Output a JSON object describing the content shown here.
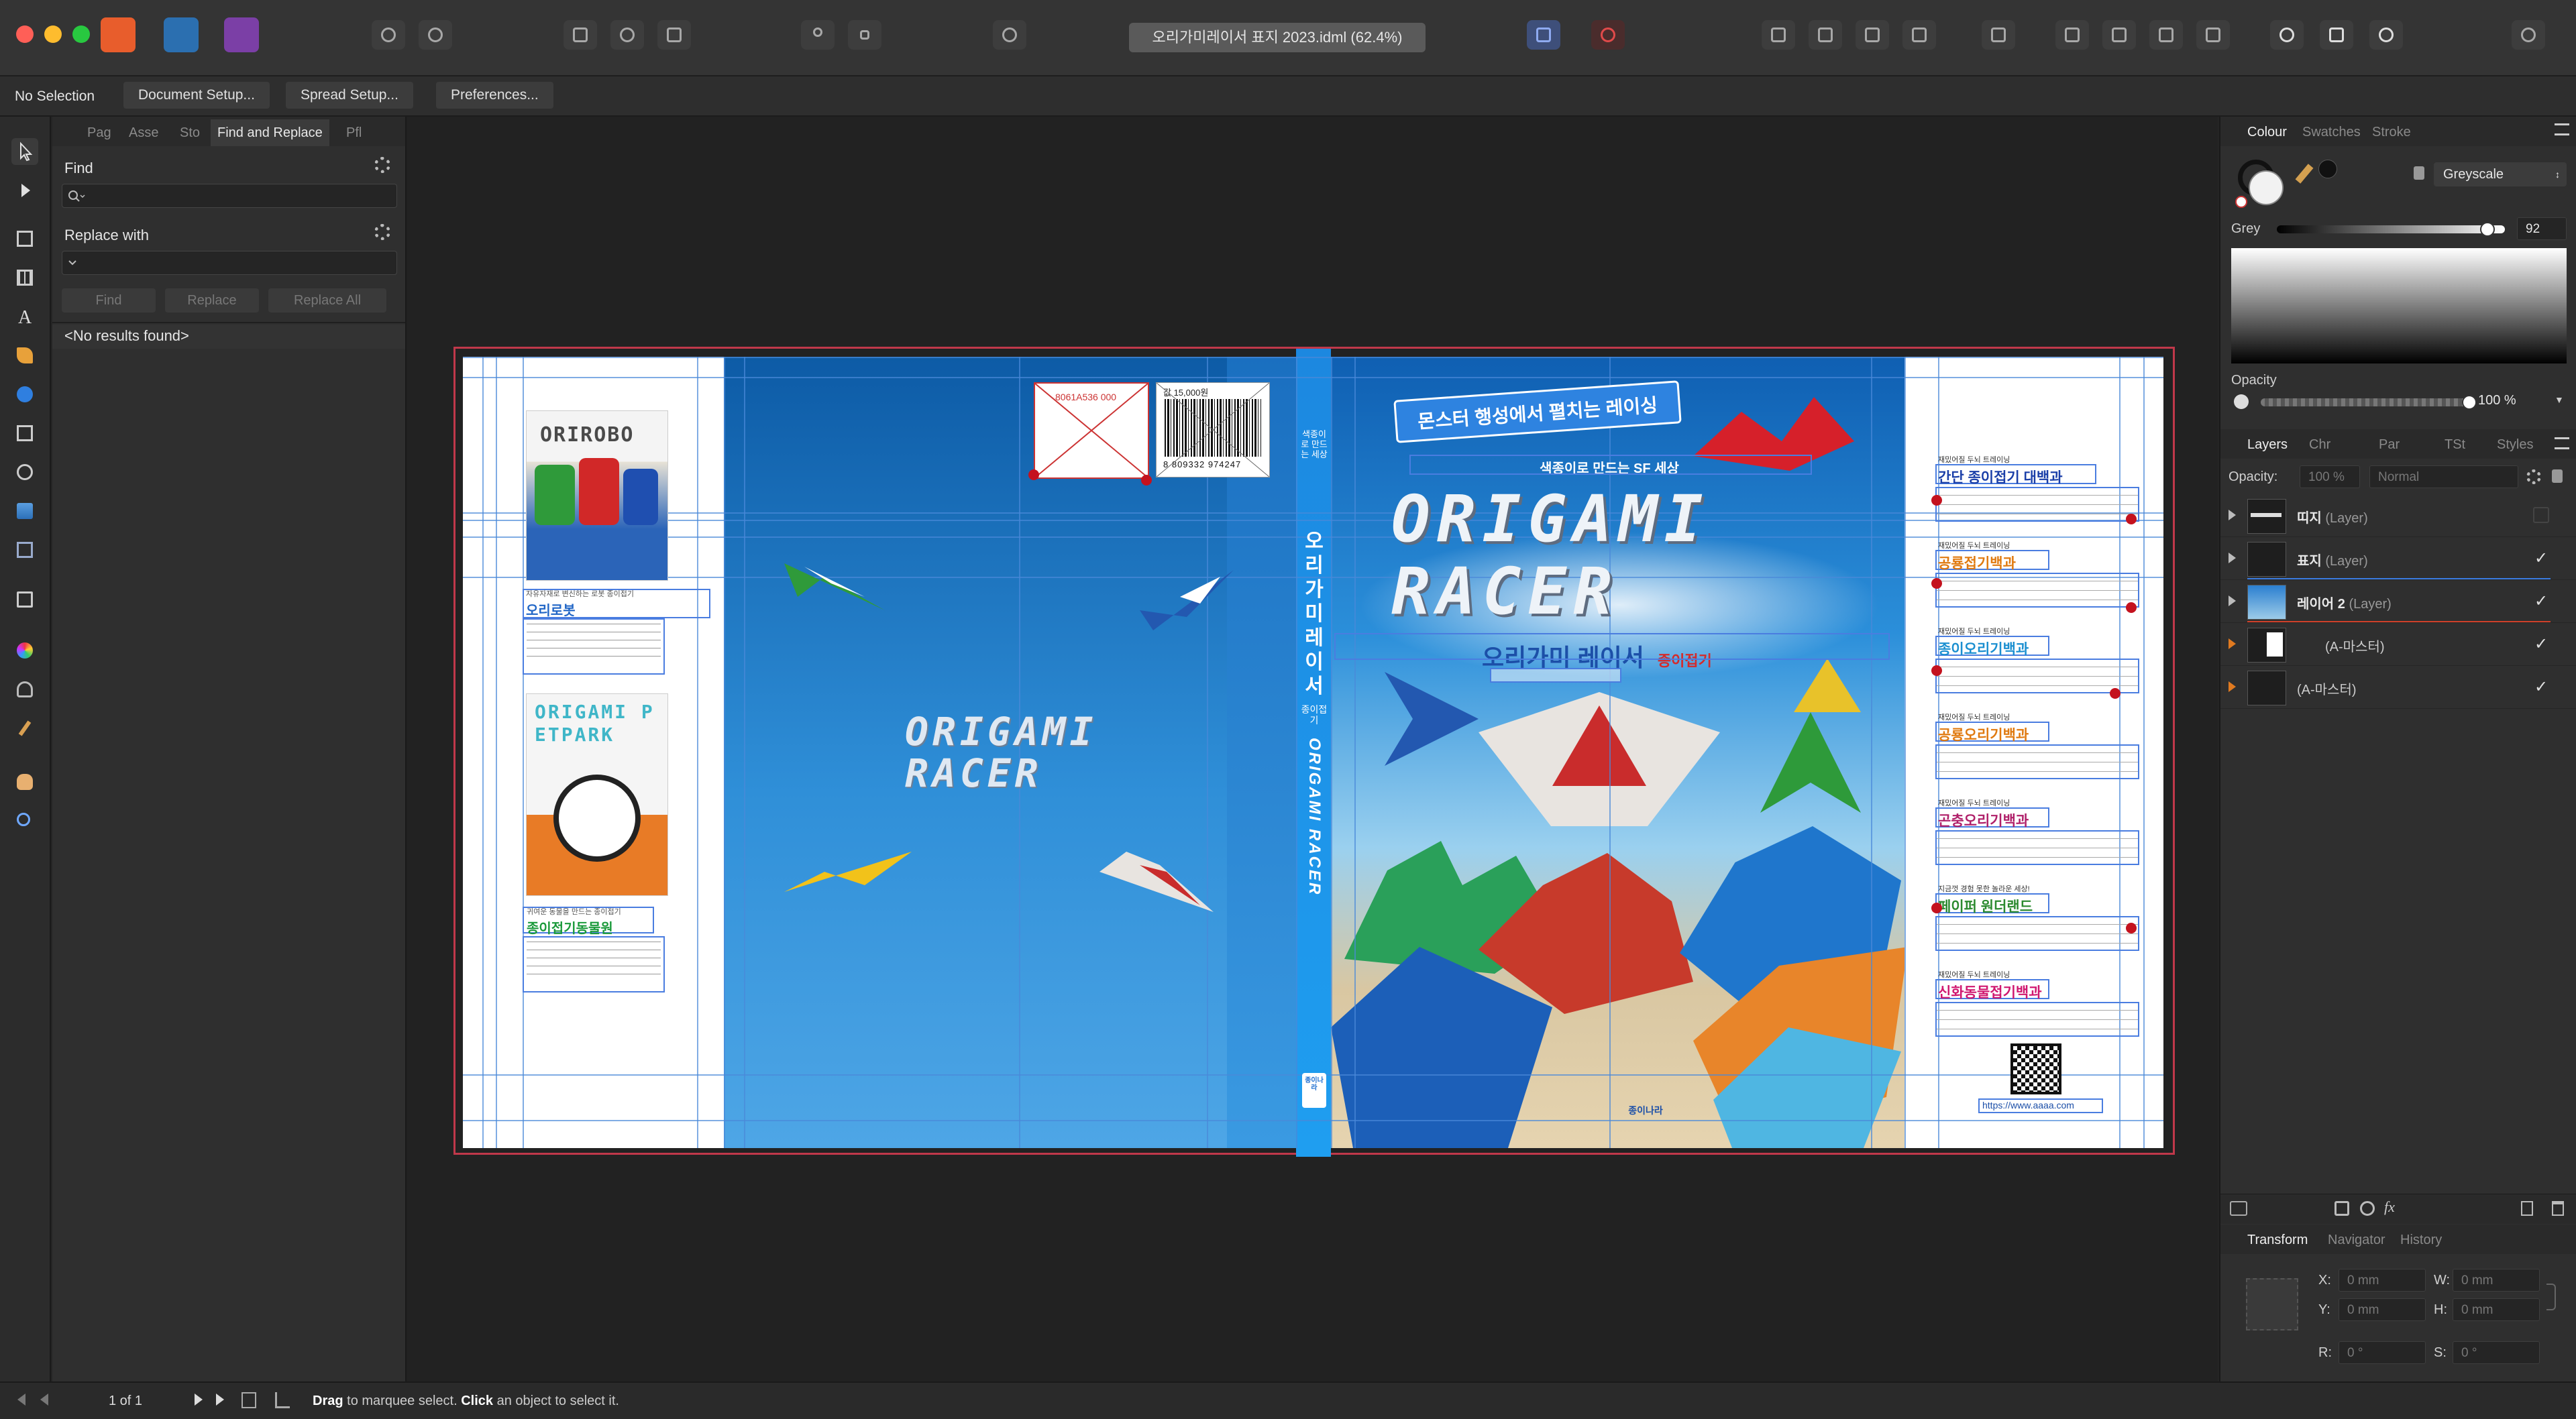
{
  "titlebar": {
    "document_title": "오리가미레이서 표지 2023.idml (62.4%)"
  },
  "context_toolbar": {
    "selection": "No Selection",
    "buttons": [
      "Document Setup...",
      "Spread Setup...",
      "Preferences..."
    ]
  },
  "left_panel": {
    "tabs": [
      "Pag",
      "Asse",
      "Sto",
      "Find and Replace",
      "Pfl"
    ],
    "active_tab": "Find and Replace",
    "find_label": "Find",
    "find_value": "",
    "replace_label": "Replace with",
    "replace_value": "",
    "buttons": [
      "Find",
      "Replace",
      "Replace All"
    ],
    "result": "<No results found>"
  },
  "cover": {
    "back_title_en_1": "ORIGAMI",
    "back_title_en_2": "RACER",
    "price_label": "값 15,000원",
    "isbn_top": "8061A536 000",
    "barcode_digits": "8 809332 974247",
    "spine_subtitle": "색종이로 만드는 세상",
    "spine_title_ko": "오리가미레이서",
    "spine_title_small": "종이접기",
    "spine_title_en": "ORIGAMI RACER",
    "spine_publisher": "종이나라",
    "banner": "몬스터 행성에서 펼치는 레이싱",
    "tagline": "색종이로 만드는 SF 세상",
    "front_title_en_1": "ORIGAMI",
    "front_title_en_2": "RACER",
    "front_title_ko": "오리가미 레이서",
    "front_title_ko_sub": "종이접기",
    "publisher_front": "종이나라",
    "website": "https://www.aaaa.com",
    "left_books": [
      {
        "cover": "ORIROBO",
        "label": "오리로봇",
        "caption": "자유자재로 변신하는 로봇 종이접기"
      },
      {
        "cover": "ORIGAMI PETPARK",
        "label": "종이접기동물원",
        "caption": "귀여운 동물을 만드는 종이접기"
      }
    ],
    "right_books": [
      {
        "kicker": "재밌어질 두뇌 트레이닝",
        "title": "간단 종이접기 대백과",
        "color": "#1b3fa8"
      },
      {
        "kicker": "재밌어질 두뇌 트레이닝",
        "title": "공룡접기백과",
        "color": "#e07a10"
      },
      {
        "kicker": "재밌어질 두뇌 트레이닝",
        "title": "종이오리기백과",
        "color": "#1b8fd0"
      },
      {
        "kicker": "재밌어질 두뇌 트레이닝",
        "title": "공룡오리기백과",
        "color": "#e07a10"
      },
      {
        "kicker": "재밌어질 두뇌 트레이닝",
        "title": "곤충오리기백과",
        "color": "#b0206a"
      },
      {
        "kicker": "지금껏 경험 못한 놀라운 세상!",
        "title": "페이퍼 원더랜드",
        "color": "#2b8a2f"
      },
      {
        "kicker": "재밌어질 두뇌 트레이닝",
        "title": "신화동물접기백과",
        "color": "#d01870"
      }
    ]
  },
  "right_panel": {
    "colour_tabs": [
      "Colour",
      "Swatches",
      "Stroke"
    ],
    "colour_mode": "Greyscale",
    "grey_label": "Grey",
    "grey_value": "92",
    "grey_level": 0.92,
    "opacity_label": "Opacity",
    "opacity_value": "100 %",
    "opacity_level": 1.0,
    "layer_tabs": [
      "Layers",
      "Chr",
      "Par",
      "TSt",
      "Styles"
    ],
    "layers_opacity_label": "Opacity:",
    "layers_opacity_value": "100 %",
    "blend_mode": "Normal",
    "layers": [
      {
        "name": "띠지",
        "type": "(Layer)",
        "visible": false
      },
      {
        "name": "표지",
        "type": "(Layer)",
        "visible": true
      },
      {
        "name": "레이어 2",
        "type": "(Layer)",
        "visible": true
      },
      {
        "name": "",
        "type": "(A-마스터)",
        "visible": true
      },
      {
        "name": "",
        "type": "(A-마스터)",
        "visible": true
      }
    ],
    "transform_tabs": [
      "Transform",
      "Navigator",
      "History"
    ],
    "transform": {
      "x_label": "X:",
      "x": "0 mm",
      "w_label": "W:",
      "w": "0 mm",
      "y_label": "Y:",
      "y": "0 mm",
      "h_label": "H:",
      "h": "0 mm",
      "r_label": "R:",
      "r": "0 °",
      "s_label": "S:",
      "s": "0 °"
    }
  },
  "statusbar": {
    "page": "1 of 1",
    "hint_bold_1": "Drag",
    "hint_1": " to marquee select. ",
    "hint_bold_2": "Click",
    "hint_2": " an object to select it."
  }
}
